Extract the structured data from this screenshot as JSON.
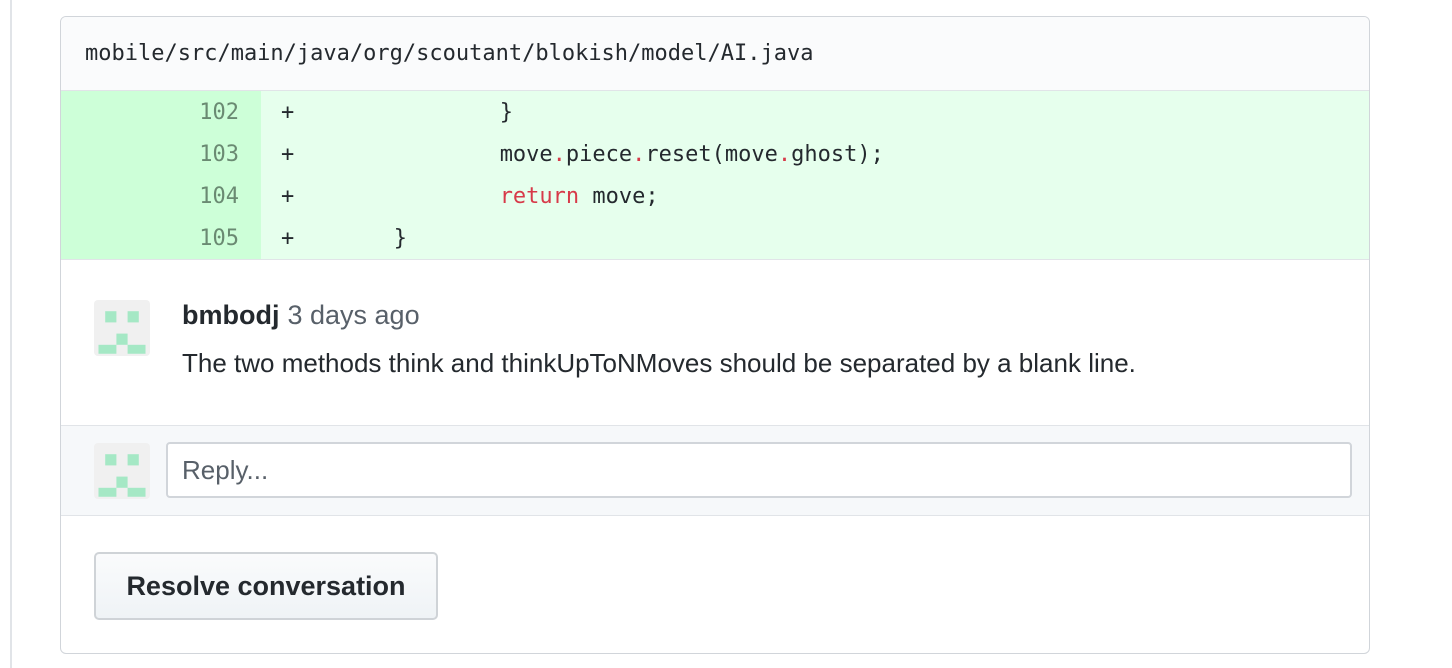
{
  "file": {
    "path": "mobile/src/main/java/org/scoutant/blokish/model/AI.java"
  },
  "diff": {
    "marker": "+",
    "lines": [
      {
        "number": "102",
        "indent": "               ",
        "brace": "}"
      },
      {
        "number": "103",
        "indent": "               ",
        "t1": "move",
        "dot": ".",
        "t2": "piece",
        "t3": "reset(move",
        "t4": "ghost);"
      },
      {
        "number": "104",
        "indent": "               ",
        "keyword": "return",
        "rest": " move;"
      },
      {
        "number": "105",
        "indent": "       ",
        "brace": "}"
      }
    ]
  },
  "comment": {
    "author": "bmbodj",
    "timestamp": "3 days ago",
    "body": "The two methods think and thinkUpToNMoves should be separated by a blank line."
  },
  "reply": {
    "placeholder": "Reply..."
  },
  "actions": {
    "resolve_label": "Resolve conversation"
  },
  "colors": {
    "added_line_bg": "#e6ffed",
    "added_num_bg": "#cdffd8",
    "keyword": "#d73a49",
    "avatar_identicon": "#a5e8c5"
  },
  "icons": {
    "avatar": "identicon-avatar"
  }
}
